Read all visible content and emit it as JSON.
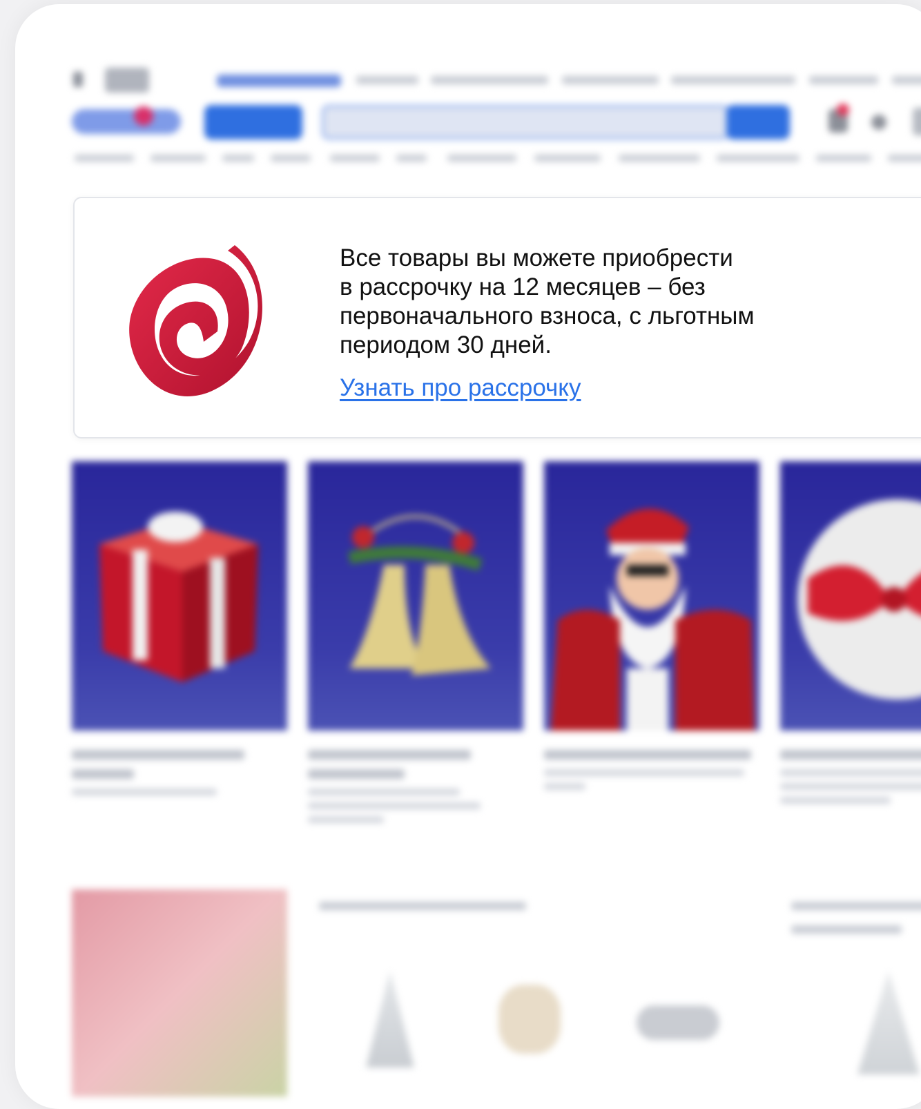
{
  "promo": {
    "logo_icon": "installment-spiral-logo",
    "brand_color": "#d81b3f",
    "text_lines": [
      "Все товары вы можете приобрести",
      "в рассрочку на 12 месяцев – без",
      "первоначального взноса, с льготным",
      "периодом 30 дней."
    ],
    "link_label": "Узнать про рассрочку",
    "link_color": "#2a72e8"
  },
  "background": {
    "accent_color": "#2f6fe0",
    "tiles": [
      {
        "icon": "gift-box-icon"
      },
      {
        "icon": "christmas-bells-icon"
      },
      {
        "icon": "santa-claus-image"
      },
      {
        "icon": "ribbon-bow-icon"
      }
    ]
  }
}
